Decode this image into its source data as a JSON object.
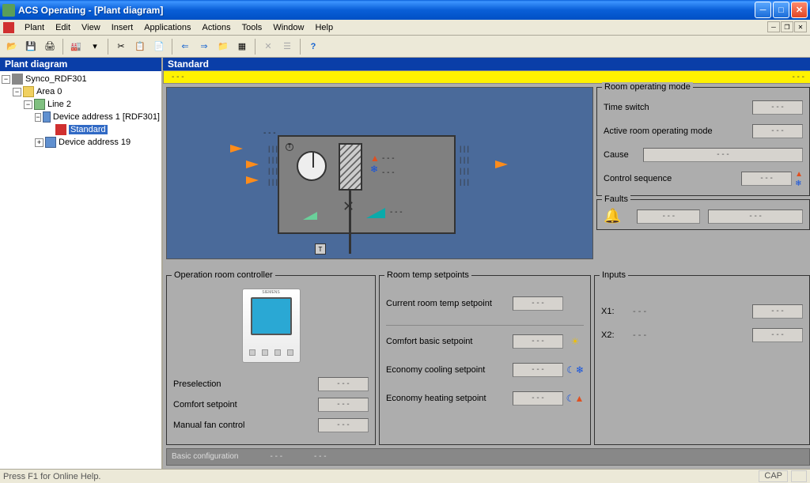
{
  "window": {
    "title": "ACS Operating - [Plant diagram]"
  },
  "menu": {
    "items": [
      "Plant",
      "Edit",
      "View",
      "Insert",
      "Applications",
      "Actions",
      "Tools",
      "Window",
      "Help"
    ]
  },
  "tree": {
    "header": "Plant diagram",
    "root": "Synco_RDF301",
    "area": "Area 0",
    "line": "Line 2",
    "dev1": "Device address 1 [RDF301]",
    "standard": "Standard",
    "dev19": "Device address 19"
  },
  "content": {
    "header": "Standard",
    "yellow_left": "- - -",
    "yellow_right": "- - -"
  },
  "diagram": {
    "dash": "- - -"
  },
  "room_mode": {
    "title": "Room operating mode",
    "time_switch": "Time switch",
    "time_switch_val": "- - -",
    "active": "Active room operating mode",
    "active_val": "- - -",
    "cause": "Cause",
    "cause_val": "- - -",
    "ctrl_seq": "Control sequence",
    "ctrl_seq_val": "- - -"
  },
  "faults": {
    "title": "Faults",
    "val1": "- - -",
    "val2": "- - -"
  },
  "op_ctrl": {
    "title": "Operation room controller",
    "brand": "SIEMENS",
    "preselection": "Preselection",
    "preselection_val": "- - -",
    "comfort": "Comfort setpoint",
    "comfort_val": "- - -",
    "fan": "Manual fan control",
    "fan_val": "- - -"
  },
  "setpoints": {
    "title": "Room temp setpoints",
    "current": "Current room temp setpoint",
    "current_val": "- - -",
    "comfort": "Comfort basic setpoint",
    "comfort_val": "- - -",
    "eco_cool": "Economy cooling setpoint",
    "eco_cool_val": "- - -",
    "eco_heat": "Economy heating setpoint",
    "eco_heat_val": "- - -"
  },
  "inputs": {
    "title": "Inputs",
    "x1_label": "X1:",
    "x1_text": "- - -",
    "x1_val": "- - -",
    "x2_label": "X2:",
    "x2_text": "- - -",
    "x2_val": "- - -"
  },
  "basic_config": {
    "label": "Basic configuration",
    "v1": "- - -",
    "v2": "- - -"
  },
  "status": {
    "help": "Press F1 for Online Help.",
    "cap": "CAP"
  }
}
